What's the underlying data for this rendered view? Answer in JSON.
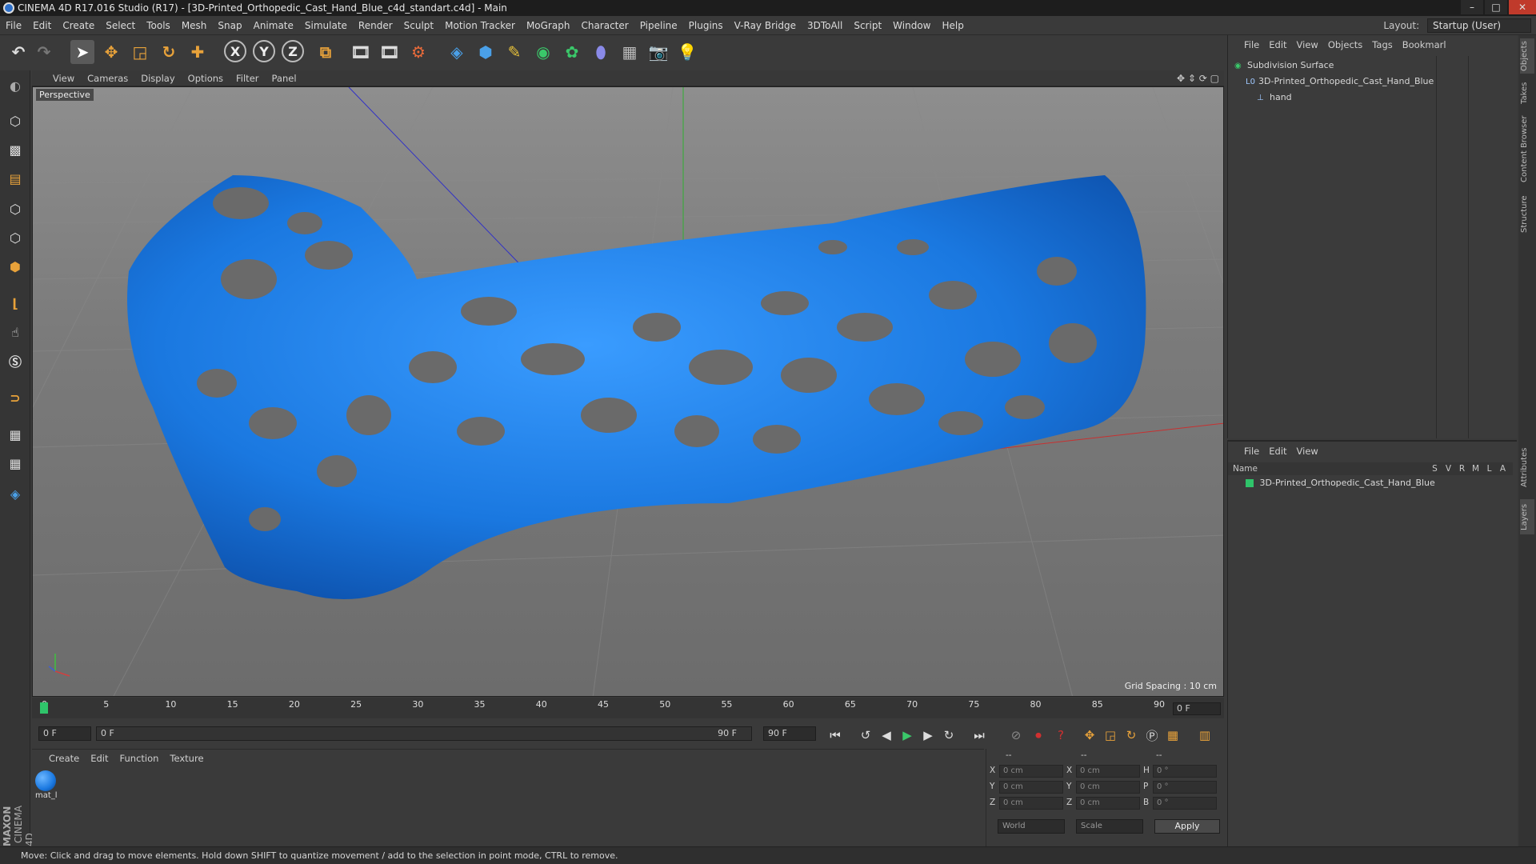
{
  "window": {
    "title": "CINEMA 4D R17.016 Studio (R17) - [3D-Printed_Orthopedic_Cast_Hand_Blue_c4d_standart.c4d] - Main",
    "minimize": "–",
    "maximize": "□",
    "close": "✕"
  },
  "menubar": {
    "items": [
      "File",
      "Edit",
      "Create",
      "Select",
      "Tools",
      "Mesh",
      "Snap",
      "Animate",
      "Simulate",
      "Render",
      "Sculpt",
      "Motion Tracker",
      "MoGraph",
      "Character",
      "Pipeline",
      "Plugins",
      "V-Ray Bridge",
      "3DToAll",
      "Script",
      "Window",
      "Help"
    ],
    "layout_label": "Layout:",
    "layout_value": "Startup (User)"
  },
  "toolbar": {
    "axis_x": "X",
    "axis_y": "Y",
    "axis_z": "Z"
  },
  "viewport": {
    "menu": [
      "View",
      "Cameras",
      "Display",
      "Options",
      "Filter",
      "Panel"
    ],
    "camera_label": "Perspective",
    "grid_spacing": "Grid Spacing : 10 cm",
    "accent_object_color": "#1a78e0"
  },
  "timeline": {
    "ticks": [
      "0",
      "5",
      "10",
      "15",
      "20",
      "25",
      "30",
      "35",
      "40",
      "45",
      "50",
      "55",
      "60",
      "65",
      "70",
      "75",
      "80",
      "85",
      "90"
    ],
    "current_frame_field": "0 F",
    "start_field": "0 F",
    "range_start": "0 F",
    "range_end": "90 F",
    "end_field": "90 F"
  },
  "material_manager": {
    "menu": [
      "Create",
      "Edit",
      "Function",
      "Texture"
    ],
    "materials": [
      {
        "name": "mat_l",
        "color": "#1a78e0"
      }
    ]
  },
  "coordinates": {
    "headers": [
      "--",
      "--",
      "--"
    ],
    "rows": [
      {
        "l1": "X",
        "v1": "0 cm",
        "l2": "X",
        "v2": "0 cm",
        "l3": "H",
        "v3": "0 °"
      },
      {
        "l1": "Y",
        "v1": "0 cm",
        "l2": "Y",
        "v2": "0 cm",
        "l3": "P",
        "v3": "0 °"
      },
      {
        "l1": "Z",
        "v1": "0 cm",
        "l2": "Z",
        "v2": "0 cm",
        "l3": "B",
        "v3": "0 °"
      }
    ],
    "mode1": "World",
    "mode2": "Scale",
    "apply": "Apply"
  },
  "object_manager": {
    "menu": [
      "File",
      "Edit",
      "View",
      "Objects",
      "Tags",
      "Bookmarl"
    ],
    "objects": [
      {
        "name": "Subdivision Surface",
        "indent": 0
      },
      {
        "name": "3D-Printed_Orthopedic_Cast_Hand_Blue",
        "indent": 1
      },
      {
        "name": "hand",
        "indent": 2
      }
    ]
  },
  "layer_manager": {
    "menu": [
      "File",
      "Edit",
      "View"
    ],
    "columns": {
      "name": "Name",
      "flags": [
        "S",
        "V",
        "R",
        "M",
        "L",
        "A"
      ]
    },
    "layers": [
      {
        "name": "3D-Printed_Orthopedic_Cast_Hand_Blue",
        "color": "#2fc46a"
      }
    ]
  },
  "right_tabs": [
    "Objects",
    "Takes",
    "Content Browser",
    "Structure",
    "Attributes",
    "Layers"
  ],
  "status": {
    "text": "Move: Click and drag to move elements. Hold down SHIFT to quantize movement / add to the selection in point mode, CTRL to remove."
  },
  "brand": {
    "line1": "MAXON",
    "line2": "CINEMA 4D"
  }
}
